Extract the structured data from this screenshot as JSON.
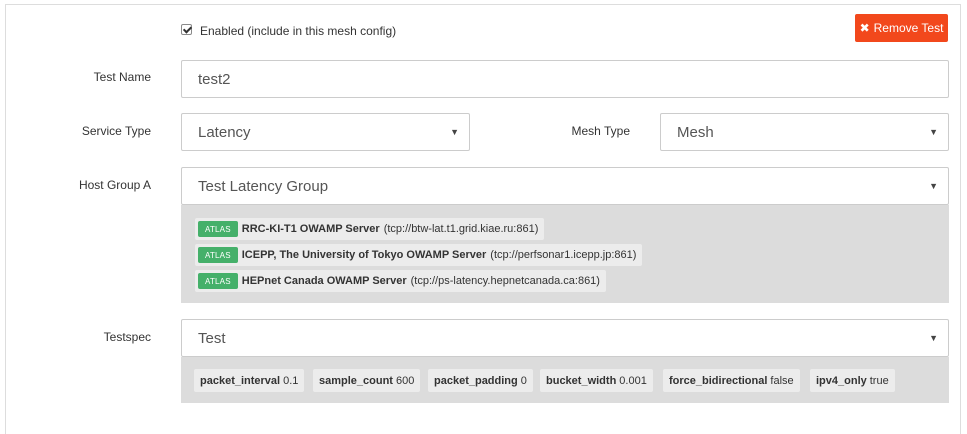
{
  "enabled": {
    "checked": true,
    "label": "Enabled (include in this mesh config)"
  },
  "remove_button": {
    "icon": "close-icon",
    "label": "Remove Test",
    "color": "#f2481c"
  },
  "test_name": {
    "label": "Test Name",
    "value": "test2"
  },
  "service_type": {
    "label": "Service Type",
    "value": "Latency"
  },
  "mesh_type": {
    "label": "Mesh Type",
    "value": "Mesh"
  },
  "host_group_a": {
    "label": "Host Group A",
    "value": "Test Latency Group",
    "hosts": [
      {
        "badge": "ATLAS",
        "name": "RRC-KI-T1 OWAMP Server",
        "address": "(tcp://btw-lat.t1.grid.kiae.ru:861)"
      },
      {
        "badge": "ATLAS",
        "name": "ICEPP, The University of Tokyo OWAMP Server",
        "address": "(tcp://perfsonar1.icepp.jp:861)"
      },
      {
        "badge": "ATLAS",
        "name": "HEPnet Canada OWAMP Server",
        "address": "(tcp://ps-latency.hepnetcanada.ca:861)"
      }
    ],
    "badge_color": "#45b06a"
  },
  "testspec": {
    "label": "Testspec",
    "value": "Test",
    "params": [
      {
        "key": "packet_interval",
        "value": "0.1"
      },
      {
        "key": "sample_count",
        "value": "600"
      },
      {
        "key": "packet_padding",
        "value": "0"
      },
      {
        "key": "bucket_width",
        "value": "0.001"
      },
      {
        "key": "force_bidirectional",
        "value": "false"
      },
      {
        "key": "ipv4_only",
        "value": "true"
      }
    ]
  }
}
